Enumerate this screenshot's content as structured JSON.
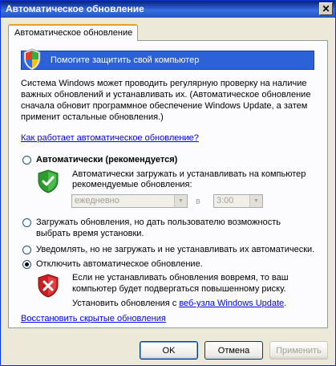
{
  "window": {
    "title": "Автоматическое обновление",
    "close_glyph": "✕"
  },
  "tab": {
    "label": "Автоматическое обновление"
  },
  "banner": {
    "text": "Помогите защитить свой компьютер"
  },
  "description": [
    "Система Windows может проводить регулярную проверку на наличие",
    "важных обновлений и устанавливать их. (Автоматическое обновление",
    "сначала обновит программное обеспечение Windows Update, а затем",
    "применит остальные обновления.)"
  ],
  "how_link": "Как работает автоматическое обновление?",
  "options": {
    "automatic": {
      "label": "Автоматически (рекомендуется)",
      "desc_lines": [
        "Автоматически загружать и устанавливать на компьютер",
        "рекомендуемые обновления:"
      ],
      "schedule": {
        "day": "ежедневно",
        "at_label": "в",
        "time": "3:00"
      }
    },
    "download": {
      "label_lines": [
        "Загружать обновления, но дать пользователю возможность",
        "выбрать время установки."
      ]
    },
    "notify": {
      "label": "Уведомлять, но не загружать и не устанавливать их автоматически."
    },
    "off": {
      "label": "Отключить автоматическое обновление.",
      "warn_lines": [
        "Если не устанавливать обновления вовремя, то ваш",
        "компьютер будет подвергаться повышенному риску."
      ],
      "install_prefix": "Установить обновления с ",
      "install_link": "веб-узла Windows Update",
      "install_suffix": "."
    }
  },
  "restore_link": "Восстановить скрытые обновления",
  "buttons": {
    "ok": "OK",
    "cancel": "Отмена",
    "apply": "Применить"
  },
  "selected_option": "off",
  "colors": {
    "banner": "#2c62d8",
    "link": "#0000ff",
    "titlebar": "#2a5bd7"
  }
}
